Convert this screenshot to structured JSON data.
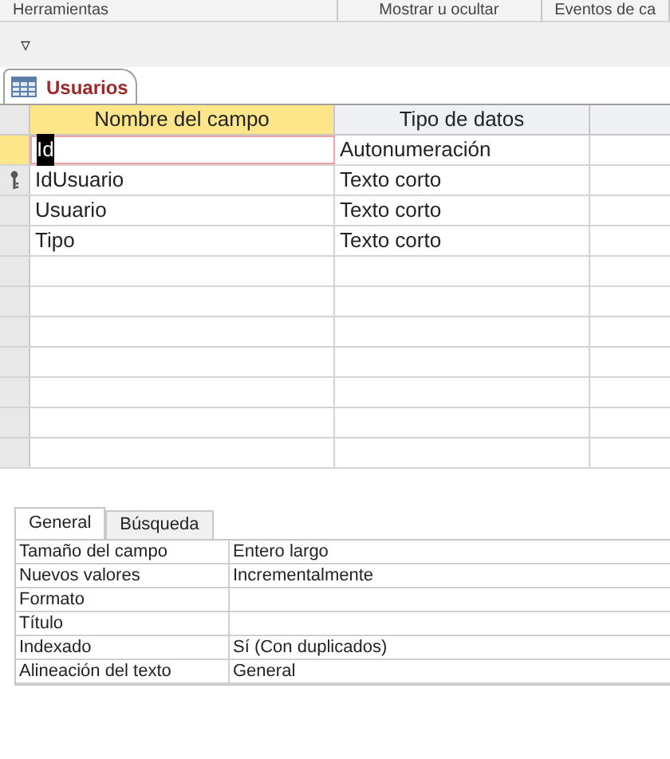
{
  "ribbon_groups": [
    "Herramientas",
    "Mostrar u ocultar",
    "Eventos de ca"
  ],
  "quick_access": {
    "glyph": "▿"
  },
  "document_tab": {
    "title": "Usuarios"
  },
  "table": {
    "columns": [
      "Nombre del campo",
      "Tipo de datos"
    ],
    "rows": [
      {
        "field": "Id",
        "type": "Autonumeración",
        "selected": true,
        "primary_key": false
      },
      {
        "field": "IdUsuario",
        "type": "Texto corto",
        "selected": false,
        "primary_key": true
      },
      {
        "field": "Usuario",
        "type": "Texto corto",
        "selected": false,
        "primary_key": false
      },
      {
        "field": "Tipo",
        "type": "Texto corto",
        "selected": false,
        "primary_key": false
      }
    ]
  },
  "properties": {
    "tabs": [
      {
        "label": "General",
        "selected": true
      },
      {
        "label": "Búsqueda",
        "selected": false
      }
    ],
    "rows": [
      {
        "label": "Tamaño del campo",
        "value": "Entero largo"
      },
      {
        "label": "Nuevos valores",
        "value": "Incrementalmente"
      },
      {
        "label": "Formato",
        "value": ""
      },
      {
        "label": "Título",
        "value": ""
      },
      {
        "label": "Indexado",
        "value": "Sí (Con duplicados)"
      },
      {
        "label": "Alineación del texto",
        "value": "General"
      }
    ]
  }
}
